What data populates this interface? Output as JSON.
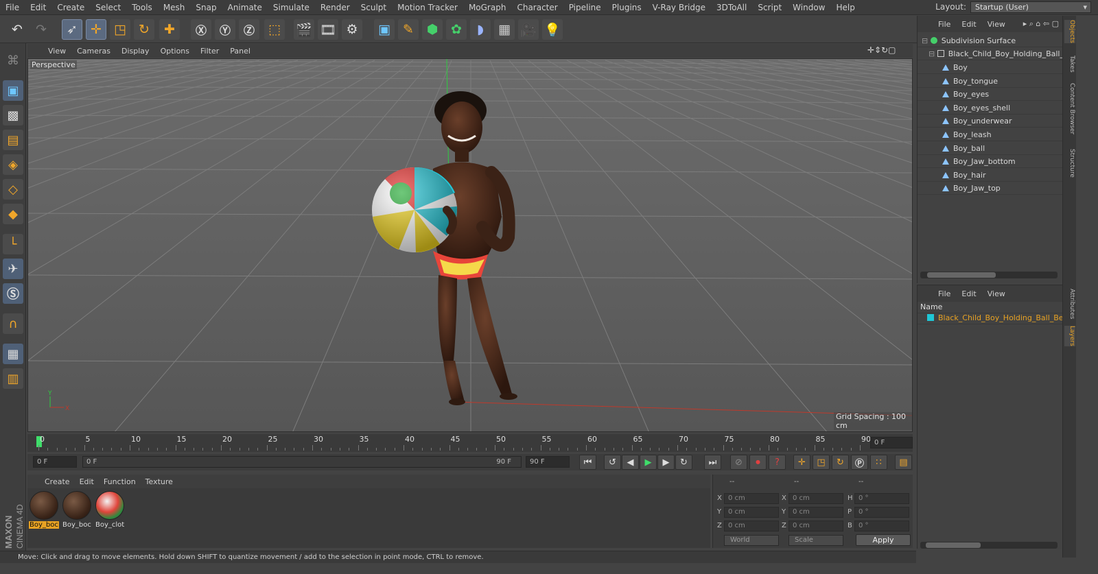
{
  "menubar": [
    "File",
    "Edit",
    "Create",
    "Select",
    "Tools",
    "Mesh",
    "Snap",
    "Animate",
    "Simulate",
    "Render",
    "Sculpt",
    "Motion Tracker",
    "MoGraph",
    "Character",
    "Pipeline",
    "Plugins",
    "V-Ray Bridge",
    "3DToAll",
    "Script",
    "Window",
    "Help"
  ],
  "layout": {
    "label": "Layout:",
    "value": "Startup (User)"
  },
  "viewport": {
    "menu": [
      "View",
      "Cameras",
      "Display",
      "Options",
      "Filter",
      "Panel"
    ],
    "camera": "Perspective",
    "grid_spacing": "Grid Spacing : 100 cm",
    "axis_y": "Y",
    "axis_x": "X"
  },
  "timeline": {
    "ticks": [
      "0",
      "5",
      "10",
      "15",
      "20",
      "25",
      "30",
      "35",
      "40",
      "45",
      "50",
      "55",
      "60",
      "65",
      "70",
      "75",
      "80",
      "85",
      "90"
    ],
    "end_field": "0 F"
  },
  "playback": {
    "start": "0 F",
    "range_start": "0 F",
    "range_end": "90 F",
    "end": "90 F"
  },
  "materials": {
    "menu": [
      "Create",
      "Edit",
      "Function",
      "Texture"
    ],
    "items": [
      {
        "label": "Boy_boc",
        "active": true
      },
      {
        "label": "Boy_boc",
        "active": false
      },
      {
        "label": "Boy_clot",
        "active": false
      }
    ]
  },
  "coords": {
    "header": [
      "--",
      "--",
      "--"
    ],
    "rows": [
      {
        "a": "X",
        "av": "0 cm",
        "b": "X",
        "bv": "0 cm",
        "c": "H",
        "cv": "0 °"
      },
      {
        "a": "Y",
        "av": "0 cm",
        "b": "Y",
        "bv": "0 cm",
        "c": "P",
        "cv": "0 °"
      },
      {
        "a": "Z",
        "av": "0 cm",
        "b": "Z",
        "bv": "0 cm",
        "c": "B",
        "cv": "0 °"
      }
    ],
    "space": "World",
    "mode": "Scale",
    "apply": "Apply"
  },
  "status": "Move: Click and drag to move elements. Hold down SHIFT to quantize movement / add to the selection in point mode, CTRL to remove.",
  "brand": {
    "maxon": "MAXON",
    "cinema": "CINEMA 4D"
  },
  "objects": {
    "menu": [
      "File",
      "Edit",
      "View"
    ],
    "root": "Subdivision Surface",
    "group": "Black_Child_Boy_Holding_Ball_Be",
    "children": [
      "Boy",
      "Boy_tongue",
      "Boy_eyes",
      "Boy_eyes_shell",
      "Boy_underwear",
      "Boy_leash",
      "Boy_ball",
      "Boy_Jaw_bottom",
      "Boy_hair",
      "Boy_Jaw_top"
    ]
  },
  "layers": {
    "menu": [
      "File",
      "Edit",
      "View"
    ],
    "col_name": "Name",
    "item": "Black_Child_Boy_Holding_Ball_Bea"
  },
  "vtabs": {
    "top": [
      "Objects",
      "Takes",
      "Content Browser",
      "Structure"
    ],
    "bottom": [
      "Attributes",
      "Layers"
    ]
  },
  "colors": {
    "accent": "#e8a223",
    "layer": "#1fc7d6",
    "grid_red": "#c0392b",
    "grid_green": "#2ecc40"
  }
}
